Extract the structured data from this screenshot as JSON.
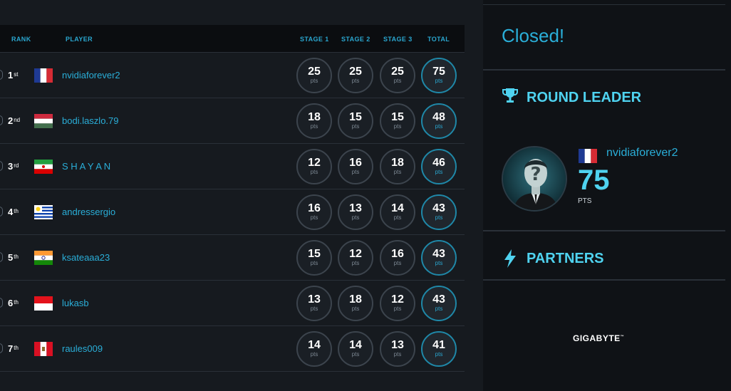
{
  "table": {
    "headers": {
      "rank": "RANK",
      "player": "PLAYER",
      "stage1": "STAGE 1",
      "stage2": "STAGE 2",
      "stage3": "STAGE 3",
      "total": "TOTAL"
    },
    "pts_label": "pts",
    "rows": [
      {
        "rank": "1",
        "suffix": "st",
        "flag": "france",
        "player": "nvidiaforever2",
        "stage1": "25",
        "stage2": "25",
        "stage3": "25",
        "total": "75"
      },
      {
        "rank": "2",
        "suffix": "nd",
        "flag": "hungary",
        "player": "bodi.laszlo.79",
        "stage1": "18",
        "stage2": "15",
        "stage3": "15",
        "total": "48"
      },
      {
        "rank": "3",
        "suffix": "rd",
        "flag": "iran",
        "player": "S H A Y A N",
        "stage1": "12",
        "stage2": "16",
        "stage3": "18",
        "total": "46"
      },
      {
        "rank": "4",
        "suffix": "th",
        "flag": "uruguay",
        "player": "andressergio",
        "stage1": "16",
        "stage2": "13",
        "stage3": "14",
        "total": "43"
      },
      {
        "rank": "5",
        "suffix": "th",
        "flag": "india",
        "player": "ksateaaa23",
        "stage1": "15",
        "stage2": "12",
        "stage3": "16",
        "total": "43"
      },
      {
        "rank": "6",
        "suffix": "th",
        "flag": "indonesia",
        "player": "lukasb",
        "stage1": "13",
        "stage2": "18",
        "stage3": "12",
        "total": "43"
      },
      {
        "rank": "7",
        "suffix": "th",
        "flag": "peru",
        "player": "raules009",
        "stage1": "14",
        "stage2": "14",
        "stage3": "13",
        "total": "41"
      }
    ]
  },
  "sidebar": {
    "status": "Closed!",
    "round_leader": {
      "title": "ROUND LEADER",
      "icon": "trophy-icon",
      "player": "nvidiaforever2",
      "flag": "france",
      "score": "75",
      "pts_label": "PTS"
    },
    "partners": {
      "title": "PARTNERS",
      "icon": "lightning-icon",
      "logo_text": "GIGABYTE",
      "logo_tm": "™"
    }
  },
  "colors": {
    "accent": "#2aaed8",
    "accent_bright": "#4fd3f0",
    "background": "#161a1f",
    "sidebar_background": "#0f1216",
    "header_background": "#0b0d10"
  }
}
